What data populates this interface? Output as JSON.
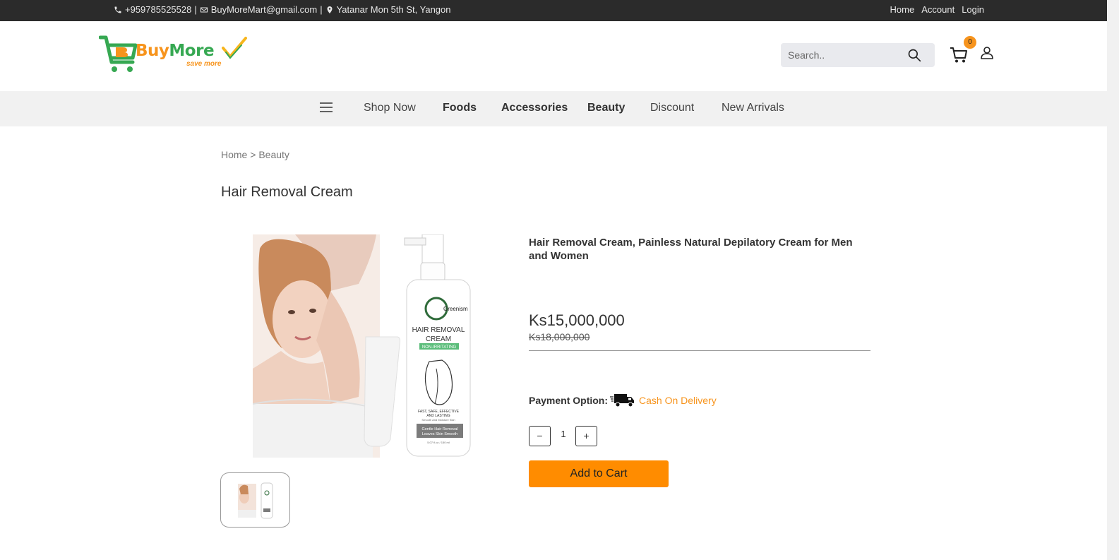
{
  "topbar": {
    "phone": "+959785525528",
    "separator": "|",
    "email": "BuyMoreMart@gmail.com",
    "address": "Yatanar Mon 5th St, Yangon",
    "links": [
      "Home",
      "Account",
      "Login"
    ]
  },
  "header": {
    "logo_buy": "Buy",
    "logo_more": "More",
    "logo_tagline": "save more",
    "search_placeholder": "Search..",
    "cart_count": "0"
  },
  "nav": {
    "items": [
      "Shop Now",
      "Foods",
      "Accessories",
      "Beauty",
      "Discount",
      "New Arrivals"
    ]
  },
  "breadcrumb": {
    "home": "Home",
    "sep": ">",
    "current": "Beauty"
  },
  "product": {
    "page_title": "Hair Removal Cream",
    "name": "Hair Removal Cream, Painless Natural Depilatory Cream for Men and Women",
    "price": "Ks15,000,000",
    "old_price": "Ks18,000,000",
    "payment_label": "Payment Option:",
    "payment_value": "Cash On Delivery",
    "quantity": "1",
    "qty_minus": "−",
    "qty_plus": "+",
    "add_to_cart": "Add to Cart",
    "image_brand": "Greenism",
    "image_label_line1": "HAIR REMOVAL",
    "image_label_line2": "CREAM",
    "image_badge": "NON-IRRITATING",
    "image_desc_line1": "FAST, SAFE, EFFECTIVE",
    "image_desc_line2": "AND LASTING",
    "image_desc_line3": "Smooth And Moisture Skin",
    "image_bottom_line1": "Gentle Hair Removal",
    "image_bottom_line2": "Leaves Skin Smooth",
    "image_volume": "5.07 fl.oz / 150 ml"
  },
  "colors": {
    "accent": "#f7941d",
    "button": "#ff8c00",
    "topbar": "#2b2b2b",
    "nav_bg": "#f1f1f1",
    "logo_green": "#36a852"
  }
}
